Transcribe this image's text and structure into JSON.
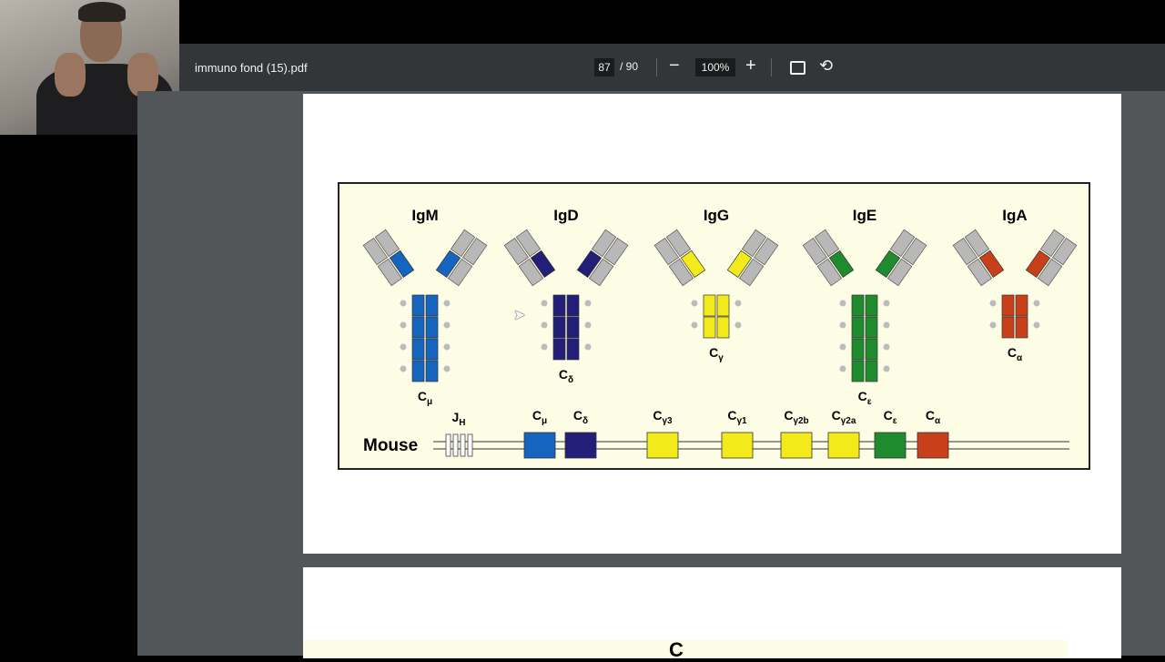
{
  "toolbar": {
    "title": "immuno fond (15).pdf",
    "page_current": "87",
    "page_total": "/ 90",
    "zoom_out": "−",
    "zoom": "100%",
    "zoom_in": "+"
  },
  "figure": {
    "antibodies": [
      {
        "name": "IgM",
        "sub": "μ",
        "color": "#1565c0",
        "domains": 4,
        "dots": true
      },
      {
        "name": "IgD",
        "sub": "δ",
        "color": "#231f78",
        "domains": 3,
        "dots": false
      },
      {
        "name": "IgG",
        "sub": "γ",
        "color": "#f2ea1a",
        "domains": 2,
        "dots": false
      },
      {
        "name": "IgE",
        "sub": "ε",
        "color": "#1e8b2e",
        "domains": 4,
        "dots": true
      },
      {
        "name": "IgA",
        "sub": "α",
        "color": "#c8401a",
        "domains": 2,
        "dots": false
      }
    ],
    "locus": {
      "species": "Mouse",
      "jh_label": "J",
      "jh_sub": "H",
      "genes": [
        {
          "sub": "μ",
          "color": "#1565c0"
        },
        {
          "sub": "δ",
          "color": "#231f78"
        },
        {
          "sub": "γ3",
          "color": "#f2ea1a"
        },
        {
          "sub": "γ1",
          "color": "#f2ea1a"
        },
        {
          "sub": "γ2b",
          "color": "#f2ea1a"
        },
        {
          "sub": "γ2a",
          "color": "#f2ea1a"
        },
        {
          "sub": "ε",
          "color": "#1e8b2e"
        },
        {
          "sub": "α",
          "color": "#c8401a"
        }
      ]
    },
    "page2_partial": "C"
  }
}
